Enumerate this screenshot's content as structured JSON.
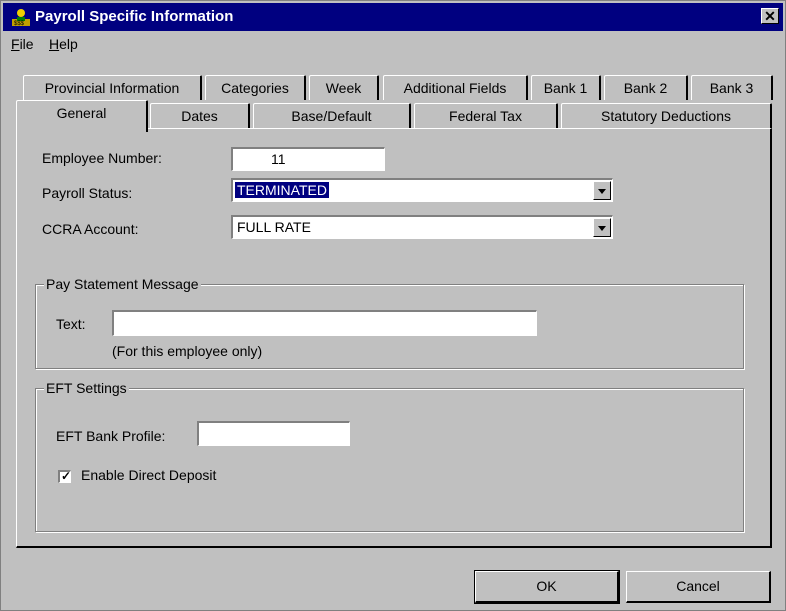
{
  "window": {
    "title": "Payroll Specific Information",
    "close_glyph": "✕"
  },
  "menu": [
    "File",
    "Help"
  ],
  "tabs_back": [
    "Provincial Information",
    "Categories",
    "Week",
    "Additional Fields",
    "Bank 1",
    "Bank 2",
    "Bank 3"
  ],
  "tabs_front": [
    "General",
    "Dates",
    "Base/Default",
    "Federal Tax",
    "Statutory Deductions"
  ],
  "active_tab": "General",
  "general": {
    "employee_number_label": "Employee Number:",
    "employee_number_value": "11",
    "payroll_status_label": "Payroll Status:",
    "payroll_status_value": "TERMINATED",
    "ccra_account_label": "CCRA Account:",
    "ccra_account_value": "FULL RATE"
  },
  "pay_statement": {
    "group_title": "Pay Statement Message",
    "text_label": "Text:",
    "text_value": "",
    "note": "(For this employee only)"
  },
  "eft": {
    "group_title": "EFT Settings",
    "bank_profile_label": "EFT Bank Profile:",
    "bank_profile_value": "",
    "direct_deposit_label": "Enable Direct Deposit",
    "direct_deposit_checked": true
  },
  "buttons": {
    "ok": "OK",
    "cancel": "Cancel"
  },
  "icons": {
    "title": "payroll-person-icon",
    "close": "close-icon",
    "dropdown": "chevron-down-icon",
    "check": "check-icon"
  },
  "colors": {
    "titlebar": "#000080",
    "face": "#c0c0c0",
    "selection": "#000080"
  }
}
